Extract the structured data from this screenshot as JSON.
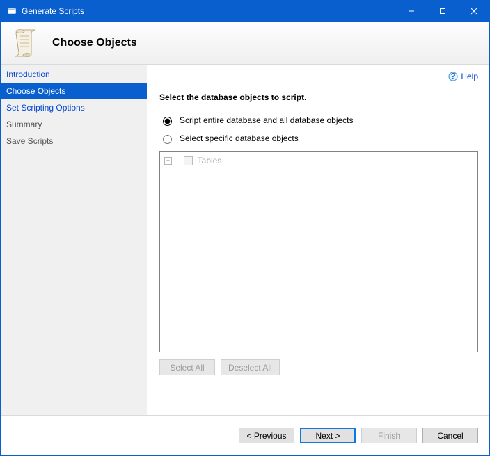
{
  "window": {
    "title": "Generate Scripts"
  },
  "header": {
    "title": "Choose Objects"
  },
  "sidebar": {
    "items": [
      {
        "label": "Introduction",
        "state": "link"
      },
      {
        "label": "Choose Objects",
        "state": "active"
      },
      {
        "label": "Set Scripting Options",
        "state": "link"
      },
      {
        "label": "Summary",
        "state": "past"
      },
      {
        "label": "Save Scripts",
        "state": "past"
      }
    ]
  },
  "main": {
    "help_label": "Help",
    "instruction": "Select the database objects to script.",
    "radio_entire": "Script entire database and all database objects",
    "radio_specific": "Select specific database objects",
    "selected_radio": "entire",
    "tree": {
      "root_label": "Tables"
    },
    "select_all_label": "Select All",
    "deselect_all_label": "Deselect All"
  },
  "footer": {
    "previous_label": "< Previous",
    "next_label": "Next >",
    "finish_label": "Finish",
    "cancel_label": "Cancel"
  }
}
